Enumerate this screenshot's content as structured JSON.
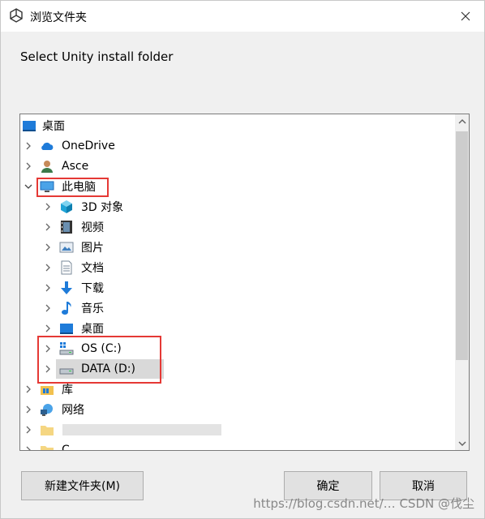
{
  "window": {
    "title": "浏览文件夹",
    "close_glyph": "✕"
  },
  "instruction": "Select Unity install folder",
  "tree": {
    "items": [
      {
        "label": "桌面",
        "icon": "desktop-icon"
      },
      {
        "label": "OneDrive",
        "icon": "cloud-icon"
      },
      {
        "label": "Asce",
        "icon": "user-icon"
      },
      {
        "label": "此电脑",
        "icon": "computer-icon"
      },
      {
        "label": "3D 对象",
        "icon": "cube-3d-icon"
      },
      {
        "label": "视频",
        "icon": "video-icon"
      },
      {
        "label": "图片",
        "icon": "pictures-icon"
      },
      {
        "label": "文档",
        "icon": "documents-icon"
      },
      {
        "label": "下载",
        "icon": "download-icon"
      },
      {
        "label": "音乐",
        "icon": "music-icon"
      },
      {
        "label": "桌面",
        "icon": "desktop-icon"
      },
      {
        "label": "OS (C:)",
        "icon": "os-drive-icon"
      },
      {
        "label": "DATA (D:)",
        "icon": "drive-icon"
      },
      {
        "label": "库",
        "icon": "library-icon"
      },
      {
        "label": "网络",
        "icon": "network-icon"
      },
      {
        "label": "",
        "icon": "folder-icon"
      },
      {
        "label": "C",
        "icon": "folder-icon"
      }
    ],
    "selected": "DATA (D:)"
  },
  "buttons": {
    "new_folder": "新建文件夹(M)",
    "ok": "确定",
    "cancel": "取消"
  },
  "watermark": "https://blog.csdn.net/… CSDN @伐尘",
  "colors": {
    "highlight": "#e53935",
    "selection": "#d9d9d9",
    "accent_blue": "#1e7bd9"
  }
}
